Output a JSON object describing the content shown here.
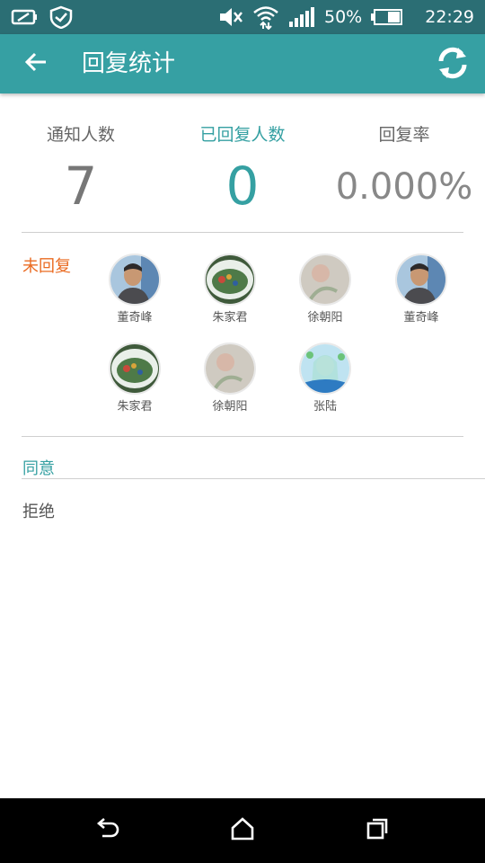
{
  "status_bar": {
    "battery": "50%",
    "time": "22:29",
    "icons": [
      "battery-saver-icon",
      "shield-check-icon",
      "mute-icon",
      "wifi-icon",
      "signal-icon",
      "battery-icon"
    ]
  },
  "header": {
    "title": "回复统计",
    "back_icon": "back-arrow-icon",
    "refresh_icon": "refresh-icon"
  },
  "stats": {
    "notified_label": "通知人数",
    "notified_value": "7",
    "replied_label": "已回复人数",
    "replied_value": "0",
    "rate_label": "回复率",
    "rate_value": "0.000%"
  },
  "sections": {
    "unreplied": "未回复",
    "agree": "同意",
    "reject": "拒绝"
  },
  "unreplied_people": [
    {
      "name": "董奇峰",
      "avatar": "photo-man"
    },
    {
      "name": "朱家君",
      "avatar": "photo-plate"
    },
    {
      "name": "徐朝阳",
      "avatar": "photo-flower"
    },
    {
      "name": "董奇峰",
      "avatar": "photo-man"
    },
    {
      "name": "朱家君",
      "avatar": "photo-plate"
    },
    {
      "name": "徐朝阳",
      "avatar": "photo-flower"
    },
    {
      "name": "张陆",
      "avatar": "photo-anime"
    }
  ],
  "colors": {
    "status_bar": "#2b6e74",
    "app_bar": "#36a0a3",
    "accent": "#35a0a2",
    "unreplied": "#ea6b22"
  },
  "nav": {
    "icons": [
      "nav-back-icon",
      "nav-home-icon",
      "nav-recents-icon"
    ]
  }
}
